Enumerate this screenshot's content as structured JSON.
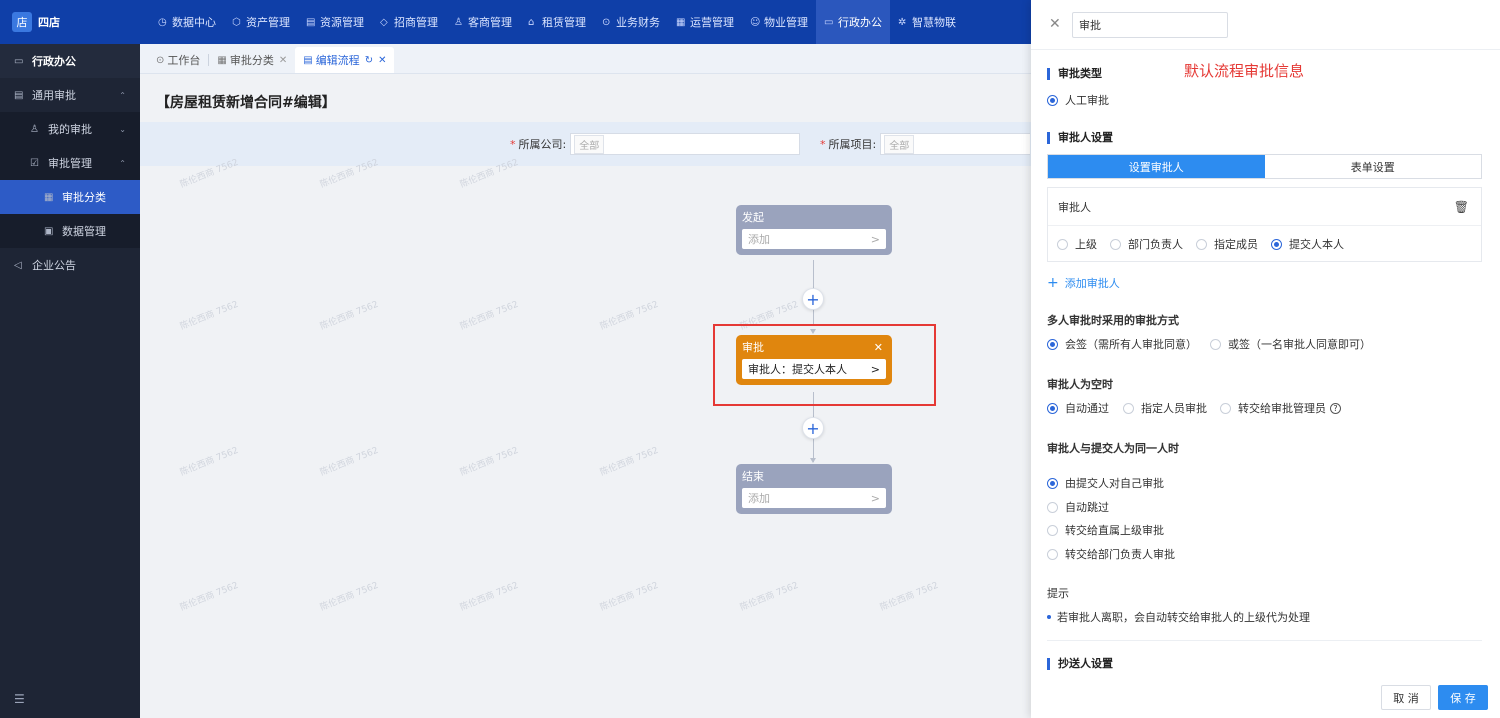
{
  "app": {
    "logo_text": "四店",
    "logo_mark": "店"
  },
  "topnav": [
    {
      "label": "数据中心",
      "icon": "◷"
    },
    {
      "label": "资产管理",
      "icon": "⬡"
    },
    {
      "label": "资源管理",
      "icon": "▤"
    },
    {
      "label": "招商管理",
      "icon": "◇"
    },
    {
      "label": "客商管理",
      "icon": "♙"
    },
    {
      "label": "租赁管理",
      "icon": "⌂"
    },
    {
      "label": "业务财务",
      "icon": "⊙"
    },
    {
      "label": "运营管理",
      "icon": "▦"
    },
    {
      "label": "物业管理",
      "icon": "☺"
    },
    {
      "label": "行政办公",
      "icon": "▭"
    },
    {
      "label": "智慧物联",
      "icon": "✲"
    }
  ],
  "sidebar": {
    "header": "行政办公",
    "items": [
      {
        "label": "通用审批",
        "chev": "⌃"
      },
      {
        "label": "我的审批",
        "chev": "⌄"
      },
      {
        "label": "审批管理",
        "chev": "⌃"
      },
      {
        "label": "审批分类"
      },
      {
        "label": "数据管理"
      },
      {
        "label": "企业公告"
      }
    ],
    "collapse_icon": "☰"
  },
  "tabs": [
    {
      "label": "工作台",
      "icon": "⊙"
    },
    {
      "label": "审批分类",
      "icon": "▦",
      "close": "✕"
    },
    {
      "label": "编辑流程",
      "icon": "▤",
      "refresh": "↻",
      "close": "✕"
    }
  ],
  "page": {
    "title": "【房屋租赁新增合同#编辑】",
    "filters": [
      {
        "label": "所属公司:",
        "tag": "全部"
      },
      {
        "label": "所属项目:",
        "tag": "全部"
      }
    ],
    "watermark": "陈伦西商 7562"
  },
  "flow": {
    "start": {
      "title": "发起",
      "body": "添加",
      "arrow": ">"
    },
    "approve": {
      "title": "审批",
      "close": "✕",
      "body": "审批人：提交人本人",
      "arrow": ">"
    },
    "end": {
      "title": "结束",
      "body": "添加",
      "arrow": ">"
    },
    "add_symbol": "+"
  },
  "drawer": {
    "close": "✕",
    "name_value": "审批",
    "note": "默认流程审批信息",
    "approval_type": {
      "title": "审批类型",
      "option": "人工审批"
    },
    "approver_settings": {
      "title": "审批人设置",
      "seg": [
        "设置审批人",
        "表单设置"
      ],
      "card_title": "审批人",
      "trash": "🗑",
      "options": [
        "上级",
        "部门负责人",
        "指定成员",
        "提交人本人"
      ]
    },
    "add_approver": "添加审批人",
    "add_plus": "+",
    "multi": {
      "title": "多人审批时采用的审批方式",
      "options": [
        "会签（需所有人审批同意）",
        "或签（一名审批人同意即可）"
      ]
    },
    "empty": {
      "title": "审批人为空时",
      "options": [
        "自动通过",
        "指定人员审批",
        "转交给审批管理员"
      ],
      "help": "?"
    },
    "same": {
      "title": "审批人与提交人为同一人时",
      "options": [
        "由提交人对自己审批",
        "自动跳过",
        "转交给直属上级审批",
        "转交给部门负责人审批"
      ]
    },
    "tip": {
      "title": "提示",
      "text": "若审批人离职，会自动转交给审批人的上级代为处理"
    },
    "cc_title": "抄送人设置",
    "cancel": "取 消",
    "save": "保 存"
  }
}
